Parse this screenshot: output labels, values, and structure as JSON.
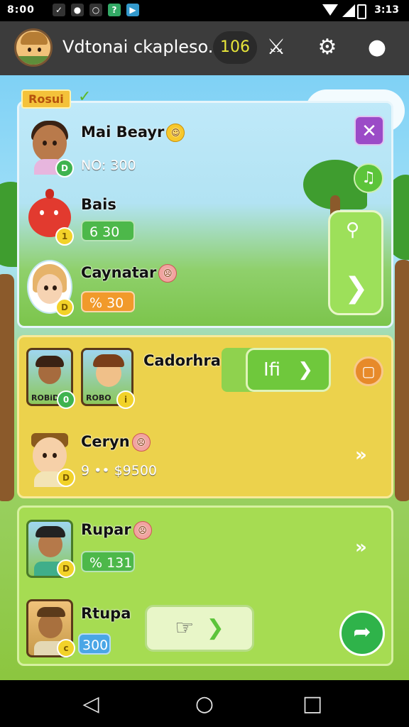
{
  "status_bar": {
    "time": "8:00",
    "right_text": "3:13"
  },
  "header": {
    "title": "Vdtonai ckapleso..",
    "score": "106"
  },
  "banner_tag": "Rosui",
  "players": [
    {
      "name": "Mai Beayr",
      "value": "NO: 300",
      "coin": "D"
    },
    {
      "name": "Bais",
      "value": "6  30",
      "coin": "1"
    },
    {
      "name": "Caynatar",
      "value": "% 30",
      "coin": "D"
    },
    {
      "name": "Cadorhra",
      "frame1_label": "ROBiDN",
      "frame2_label": "ROBO"
    },
    {
      "name": "Ceryn",
      "value": "9 •• $9500"
    },
    {
      "name": "Rupar",
      "value": "% 131"
    },
    {
      "name": "Rtupa",
      "value": "300"
    }
  ],
  "buttons": {
    "play_label": "Ifi",
    "coin_labels": [
      "D",
      "1",
      "D",
      "0",
      "i",
      "D",
      "D",
      "c"
    ]
  },
  "colors": {
    "header_bg": "#3c3c3c",
    "panel_blue": "#b2e3f3",
    "panel_yellow": "#ecd24c",
    "panel_green": "#a6dc52",
    "button_green": "#5cc43a",
    "button_purple": "#9b4bc7",
    "pill_orange": "#f19a2b",
    "pill_green": "#4db84a",
    "pill_blue": "#4aa6e6"
  },
  "icons": [
    "app-icons",
    "wifi-icon",
    "signal-icon",
    "battery-icon",
    "swords-icon",
    "gear-icon",
    "chat-icon",
    "close-icon",
    "music-icon",
    "search-icon",
    "arrow-right-icon",
    "stop-icon",
    "double-chevron-icon",
    "hand-icon",
    "back-arrow-icon",
    "nav-back-icon",
    "nav-home-icon",
    "nav-recent-icon"
  ]
}
